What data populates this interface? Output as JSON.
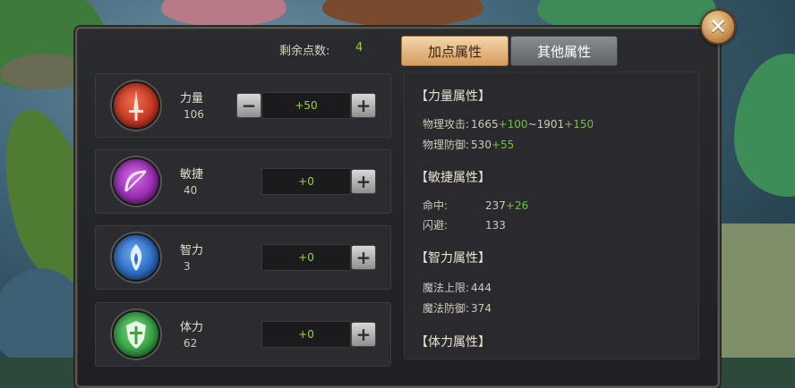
{
  "header": {
    "points_label": "剩余点数:",
    "points_value": "4",
    "tabs": [
      {
        "label": "加点属性",
        "active": true
      },
      {
        "label": "其他属性",
        "active": false
      }
    ]
  },
  "stats": [
    {
      "name": "力量",
      "value": "106",
      "delta": "+50",
      "has_minus": true,
      "icon": "strength-sword-emblem-icon",
      "color": "#c93a25"
    },
    {
      "name": "敏捷",
      "value": "40",
      "delta": "+0",
      "has_minus": false,
      "icon": "agility-bow-emblem-icon",
      "color": "#9a2fb5"
    },
    {
      "name": "智力",
      "value": "3",
      "delta": "+0",
      "has_minus": false,
      "icon": "intellect-flame-emblem-icon",
      "color": "#2f6fc6"
    },
    {
      "name": "体力",
      "value": "62",
      "delta": "+0",
      "has_minus": false,
      "icon": "stamina-shield-emblem-icon",
      "color": "#3aa547"
    }
  ],
  "sections": {
    "strength": {
      "title": "【力量属性】",
      "phys_attack": {
        "label": "物理攻击:",
        "base_min": "1665",
        "bonus_min": "+100",
        "sep": "~",
        "base_max": "1901",
        "bonus_max": "+150"
      },
      "phys_defense": {
        "label": "物理防御:",
        "base": "530",
        "bonus": "+55"
      }
    },
    "agility": {
      "title": "【敏捷属性】",
      "hit": {
        "label": "命中:",
        "base": "237",
        "bonus": "+26"
      },
      "dodge": {
        "label": "闪避:",
        "base": "133"
      }
    },
    "intellect": {
      "title": "【智力属性】",
      "mana_max": {
        "label": "魔法上限:",
        "base": "444"
      },
      "magic_defense": {
        "label": "魔法防御:",
        "base": "374"
      }
    },
    "stamina": {
      "title": "【体力属性】"
    }
  },
  "colors": {
    "bonus_green": "#6fc23c",
    "tab_active": "#e6b47c",
    "tab_inactive": "#7a7e83"
  }
}
